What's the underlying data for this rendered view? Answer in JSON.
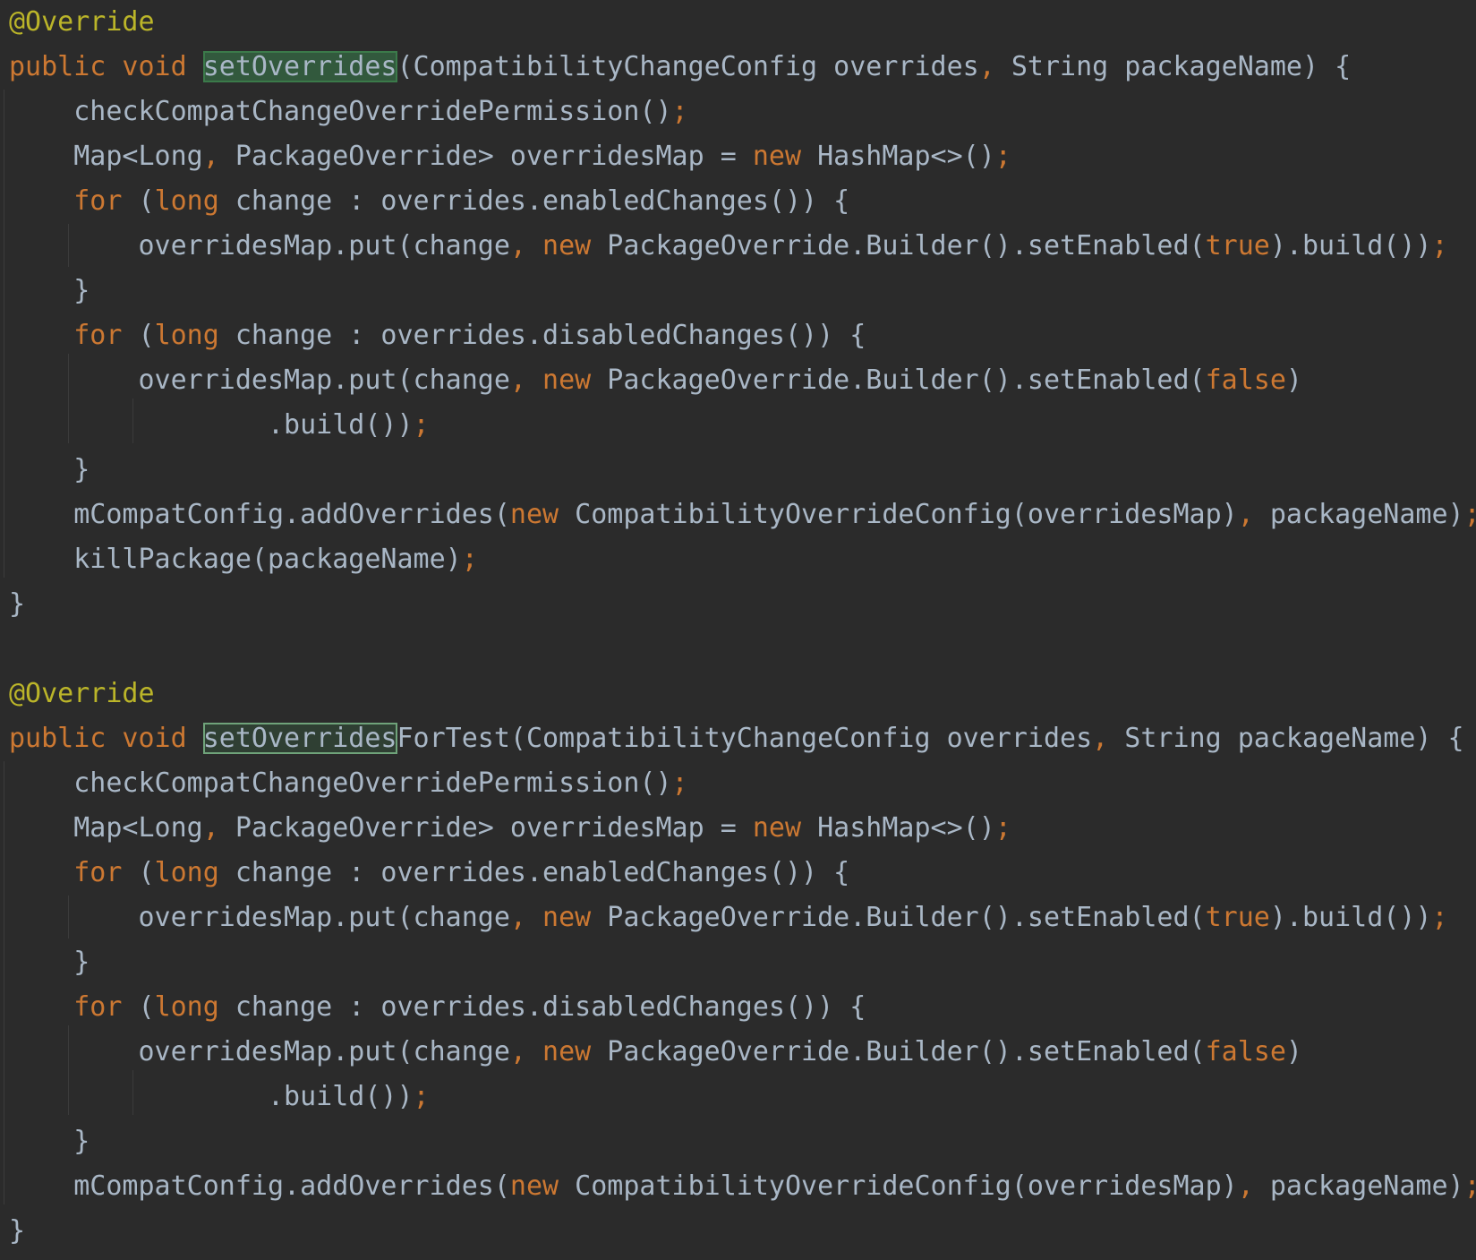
{
  "editor": {
    "language": "Java",
    "theme": {
      "background": "#2b2b2b",
      "text": "#a9b7c6",
      "keyword": "#cc7832",
      "annotation": "#bbb529",
      "usage_highlight": "#32593d"
    },
    "methods": [
      {
        "lines": [
          [
            {
              "t": "@Override",
              "c": "tok-ann"
            }
          ],
          [
            {
              "t": "public void ",
              "c": "tok-kw"
            },
            {
              "t": "setOverrides",
              "c": "tok-hl-fill"
            },
            {
              "t": "(CompatibilityChangeConfig overrides",
              "c": "tok-plain"
            },
            {
              "t": ", ",
              "c": "tok-punc"
            },
            {
              "t": "String packageName) {",
              "c": "tok-plain"
            }
          ],
          [
            {
              "t": "    checkCompatChangeOverridePermission()",
              "c": "tok-plain"
            },
            {
              "t": ";",
              "c": "tok-punc"
            }
          ],
          [
            {
              "t": "    Map<Long",
              "c": "tok-plain"
            },
            {
              "t": ", ",
              "c": "tok-punc"
            },
            {
              "t": "PackageOverride> overridesMap = ",
              "c": "tok-plain"
            },
            {
              "t": "new ",
              "c": "tok-kw"
            },
            {
              "t": "HashMap<>()",
              "c": "tok-plain"
            },
            {
              "t": ";",
              "c": "tok-punc"
            }
          ],
          [
            {
              "t": "    ",
              "c": "tok-plain"
            },
            {
              "t": "for ",
              "c": "tok-kw"
            },
            {
              "t": "(",
              "c": "tok-plain"
            },
            {
              "t": "long ",
              "c": "tok-kw"
            },
            {
              "t": "change : overrides.enabledChanges()) {",
              "c": "tok-plain"
            }
          ],
          [
            {
              "t": "        overridesMap.put(change",
              "c": "tok-plain"
            },
            {
              "t": ", ",
              "c": "tok-punc"
            },
            {
              "t": "new ",
              "c": "tok-kw"
            },
            {
              "t": "PackageOverride.Builder().setEnabled(",
              "c": "tok-plain"
            },
            {
              "t": "true",
              "c": "tok-kw"
            },
            {
              "t": ").build())",
              "c": "tok-plain"
            },
            {
              "t": ";",
              "c": "tok-punc"
            }
          ],
          [
            {
              "t": "    }",
              "c": "tok-plain"
            }
          ],
          [
            {
              "t": "    ",
              "c": "tok-plain"
            },
            {
              "t": "for ",
              "c": "tok-kw"
            },
            {
              "t": "(",
              "c": "tok-plain"
            },
            {
              "t": "long ",
              "c": "tok-kw"
            },
            {
              "t": "change : overrides.disabledChanges()) {",
              "c": "tok-plain"
            }
          ],
          [
            {
              "t": "        overridesMap.put(change",
              "c": "tok-plain"
            },
            {
              "t": ", ",
              "c": "tok-punc"
            },
            {
              "t": "new ",
              "c": "tok-kw"
            },
            {
              "t": "PackageOverride.Builder().setEnabled(",
              "c": "tok-plain"
            },
            {
              "t": "false",
              "c": "tok-kw"
            },
            {
              "t": ")",
              "c": "tok-plain"
            }
          ],
          [
            {
              "t": "                .build())",
              "c": "tok-plain"
            },
            {
              "t": ";",
              "c": "tok-punc"
            }
          ],
          [
            {
              "t": "    }",
              "c": "tok-plain"
            }
          ],
          [
            {
              "t": "    mCompatConfig.addOverrides(",
              "c": "tok-plain"
            },
            {
              "t": "new ",
              "c": "tok-kw"
            },
            {
              "t": "CompatibilityOverrideConfig(overridesMap)",
              "c": "tok-plain"
            },
            {
              "t": ", ",
              "c": "tok-punc"
            },
            {
              "t": "packageName)",
              "c": "tok-plain"
            },
            {
              "t": ";",
              "c": "tok-punc"
            }
          ],
          [
            {
              "t": "    killPackage(packageName)",
              "c": "tok-plain"
            },
            {
              "t": ";",
              "c": "tok-punc"
            }
          ],
          [
            {
              "t": "}",
              "c": "tok-plain"
            }
          ]
        ]
      },
      {
        "lines": [
          [
            {
              "t": "@Override",
              "c": "tok-ann"
            }
          ],
          [
            {
              "t": "public void ",
              "c": "tok-kw"
            },
            {
              "t": "setOverrides",
              "c": "tok-hl-box"
            },
            {
              "t": "ForTest(CompatibilityChangeConfig overrides",
              "c": "tok-plain"
            },
            {
              "t": ", ",
              "c": "tok-punc"
            },
            {
              "t": "String packageName) {",
              "c": "tok-plain"
            }
          ],
          [
            {
              "t": "    checkCompatChangeOverridePermission()",
              "c": "tok-plain"
            },
            {
              "t": ";",
              "c": "tok-punc"
            }
          ],
          [
            {
              "t": "    Map<Long",
              "c": "tok-plain"
            },
            {
              "t": ", ",
              "c": "tok-punc"
            },
            {
              "t": "PackageOverride> overridesMap = ",
              "c": "tok-plain"
            },
            {
              "t": "new ",
              "c": "tok-kw"
            },
            {
              "t": "HashMap<>()",
              "c": "tok-plain"
            },
            {
              "t": ";",
              "c": "tok-punc"
            }
          ],
          [
            {
              "t": "    ",
              "c": "tok-plain"
            },
            {
              "t": "for ",
              "c": "tok-kw"
            },
            {
              "t": "(",
              "c": "tok-plain"
            },
            {
              "t": "long ",
              "c": "tok-kw"
            },
            {
              "t": "change : overrides.enabledChanges()) {",
              "c": "tok-plain"
            }
          ],
          [
            {
              "t": "        overridesMap.put(change",
              "c": "tok-plain"
            },
            {
              "t": ", ",
              "c": "tok-punc"
            },
            {
              "t": "new ",
              "c": "tok-kw"
            },
            {
              "t": "PackageOverride.Builder().setEnabled(",
              "c": "tok-plain"
            },
            {
              "t": "true",
              "c": "tok-kw"
            },
            {
              "t": ").build())",
              "c": "tok-plain"
            },
            {
              "t": ";",
              "c": "tok-punc"
            }
          ],
          [
            {
              "t": "    }",
              "c": "tok-plain"
            }
          ],
          [
            {
              "t": "    ",
              "c": "tok-plain"
            },
            {
              "t": "for ",
              "c": "tok-kw"
            },
            {
              "t": "(",
              "c": "tok-plain"
            },
            {
              "t": "long ",
              "c": "tok-kw"
            },
            {
              "t": "change : overrides.disabledChanges()) {",
              "c": "tok-plain"
            }
          ],
          [
            {
              "t": "        overridesMap.put(change",
              "c": "tok-plain"
            },
            {
              "t": ", ",
              "c": "tok-punc"
            },
            {
              "t": "new ",
              "c": "tok-kw"
            },
            {
              "t": "PackageOverride.Builder().setEnabled(",
              "c": "tok-plain"
            },
            {
              "t": "false",
              "c": "tok-kw"
            },
            {
              "t": ")",
              "c": "tok-plain"
            }
          ],
          [
            {
              "t": "                .build())",
              "c": "tok-plain"
            },
            {
              "t": ";",
              "c": "tok-punc"
            }
          ],
          [
            {
              "t": "    }",
              "c": "tok-plain"
            }
          ],
          [
            {
              "t": "    mCompatConfig.addOverrides(",
              "c": "tok-plain"
            },
            {
              "t": "new ",
              "c": "tok-kw"
            },
            {
              "t": "CompatibilityOverrideConfig(overridesMap)",
              "c": "tok-plain"
            },
            {
              "t": ", ",
              "c": "tok-punc"
            },
            {
              "t": "packageName)",
              "c": "tok-plain"
            },
            {
              "t": ";",
              "c": "tok-punc"
            }
          ],
          [
            {
              "t": "}",
              "c": "tok-plain"
            }
          ]
        ]
      }
    ]
  }
}
